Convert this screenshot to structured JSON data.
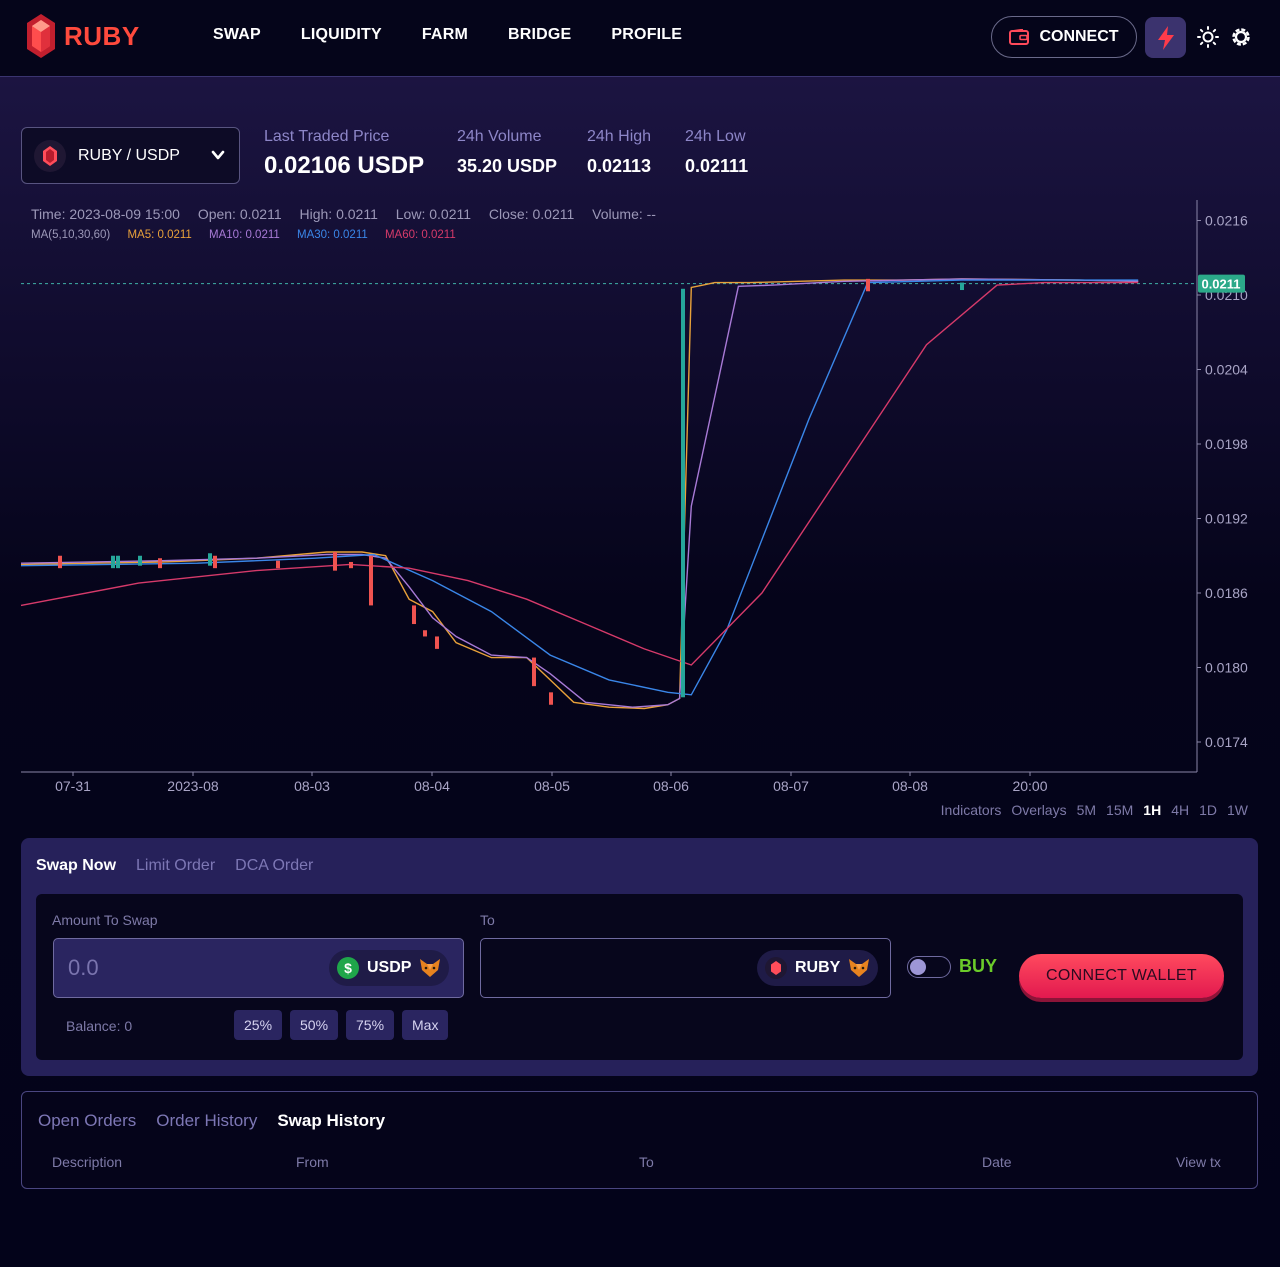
{
  "nav": {
    "brand": "RUBY",
    "links": [
      "SWAP",
      "LIQUIDITY",
      "FARM",
      "BRIDGE",
      "PROFILE"
    ],
    "connect_label": "CONNECT"
  },
  "market": {
    "pair": "RUBY / USDP",
    "last_price_label": "Last Traded Price",
    "last_price": "0.02106 USDP",
    "volume_label": "24h Volume",
    "volume": "35.20 USDP",
    "high_label": "24h High",
    "high": "0.02113",
    "low_label": "24h Low",
    "low": "0.02111"
  },
  "ohlc": {
    "time": "Time: 2023-08-09 15:00",
    "open": "Open: 0.0211",
    "high": "High: 0.0211",
    "low": "Low: 0.0211",
    "close": "Close: 0.0211",
    "volume": "Volume: --",
    "ma_label": "MA(5,10,30,60)",
    "ma5": "MA5: 0.0211",
    "ma10": "MA10: 0.0211",
    "ma30": "MA30: 0.0211",
    "ma60": "MA60: 0.0211"
  },
  "chart_data": {
    "type": "line",
    "ylim": [
      0.0172,
      0.0218
    ],
    "y_ticks": [
      0.0216,
      0.021,
      0.0204,
      0.0198,
      0.0192,
      0.0186,
      0.018,
      0.0174
    ],
    "y_tick_labels": [
      "0.0216",
      "0.0210",
      "0.0204",
      "0.0198",
      "0.0192",
      "0.0186",
      "0.0180",
      "0.0174"
    ],
    "x_tick_labels": [
      "07-31",
      "2023-08",
      "08-03",
      "08-04",
      "08-05",
      "08-06",
      "08-07",
      "08-08",
      "20:00"
    ],
    "current_price": 0.0211,
    "current_price_label": "0.0211",
    "colors": {
      "ma5": "#e8a13a",
      "ma10": "#a87ad6",
      "ma30": "#3a86e8",
      "ma60": "#d63a6a",
      "up": "#26a69a",
      "down": "#ef5350",
      "price_tag": "#2ba989"
    },
    "series": [
      {
        "name": "MA5",
        "color": "#e8a13a",
        "x": [
          0,
          0.12,
          0.2,
          0.26,
          0.29,
          0.31,
          0.33,
          0.35,
          0.37,
          0.4,
          0.43,
          0.45,
          0.47,
          0.5,
          0.53,
          0.55,
          0.56,
          0.57,
          0.58,
          0.59,
          0.62,
          0.7,
          0.75,
          0.8,
          0.9,
          0.95
        ],
        "y": [
          0.01883,
          0.01885,
          0.01888,
          0.01893,
          0.01893,
          0.0189,
          0.01855,
          0.01845,
          0.0182,
          0.01808,
          0.01808,
          0.0179,
          0.01772,
          0.01768,
          0.01767,
          0.0177,
          0.01775,
          0.02106,
          0.02108,
          0.0211,
          0.0211,
          0.02112,
          0.02112,
          0.02113,
          0.02112,
          0.02111
        ]
      },
      {
        "name": "MA10",
        "color": "#a87ad6",
        "x": [
          0,
          0.12,
          0.2,
          0.26,
          0.29,
          0.31,
          0.33,
          0.35,
          0.37,
          0.4,
          0.43,
          0.45,
          0.48,
          0.52,
          0.55,
          0.56,
          0.57,
          0.61,
          0.64,
          0.7,
          0.75,
          0.8,
          0.9,
          0.95
        ],
        "y": [
          0.01884,
          0.01886,
          0.01888,
          0.01891,
          0.01891,
          0.01888,
          0.01865,
          0.0184,
          0.01825,
          0.0181,
          0.01808,
          0.01795,
          0.01772,
          0.01768,
          0.0177,
          0.01775,
          0.0193,
          0.02107,
          0.02108,
          0.02111,
          0.02112,
          0.02113,
          0.02112,
          0.02111
        ]
      },
      {
        "name": "MA30",
        "color": "#3a86e8",
        "x": [
          0,
          0.15,
          0.25,
          0.3,
          0.35,
          0.4,
          0.45,
          0.5,
          0.55,
          0.57,
          0.6,
          0.67,
          0.72,
          0.8,
          0.9,
          0.95
        ],
        "y": [
          0.01882,
          0.01884,
          0.01888,
          0.01891,
          0.0187,
          0.01845,
          0.0181,
          0.0179,
          0.0178,
          0.01778,
          0.0183,
          0.02,
          0.0211,
          0.02112,
          0.02112,
          0.02112
        ]
      },
      {
        "name": "MA60",
        "color": "#d63a6a",
        "x": [
          0,
          0.1,
          0.2,
          0.28,
          0.33,
          0.38,
          0.43,
          0.48,
          0.53,
          0.57,
          0.63,
          0.7,
          0.77,
          0.83,
          0.87,
          0.95
        ],
        "y": [
          0.0185,
          0.01868,
          0.01878,
          0.01883,
          0.0188,
          0.0187,
          0.01855,
          0.01835,
          0.01815,
          0.01802,
          0.0186,
          0.0196,
          0.0206,
          0.02108,
          0.0211,
          0.0211
        ]
      }
    ]
  },
  "chart_controls": [
    "Indicators",
    "Overlays",
    "5M",
    "15M",
    "1H",
    "4H",
    "1D",
    "1W"
  ],
  "chart_controls_active": "1H",
  "swap": {
    "tabs": [
      "Swap Now",
      "Limit Order",
      "DCA Order"
    ],
    "amount_label": "Amount To Swap",
    "amount_placeholder": "0.0",
    "from_token": "USDP",
    "to_label": "To",
    "to_token": "RUBY",
    "balance": "Balance: 0",
    "percents": [
      "25%",
      "50%",
      "75%",
      "Max"
    ],
    "mode_label": "BUY",
    "connect_wallet": "CONNECT WALLET"
  },
  "history": {
    "tabs": [
      "Open Orders",
      "Order History",
      "Swap History"
    ],
    "columns": [
      "Description",
      "From",
      "To",
      "Date",
      "View tx"
    ]
  }
}
